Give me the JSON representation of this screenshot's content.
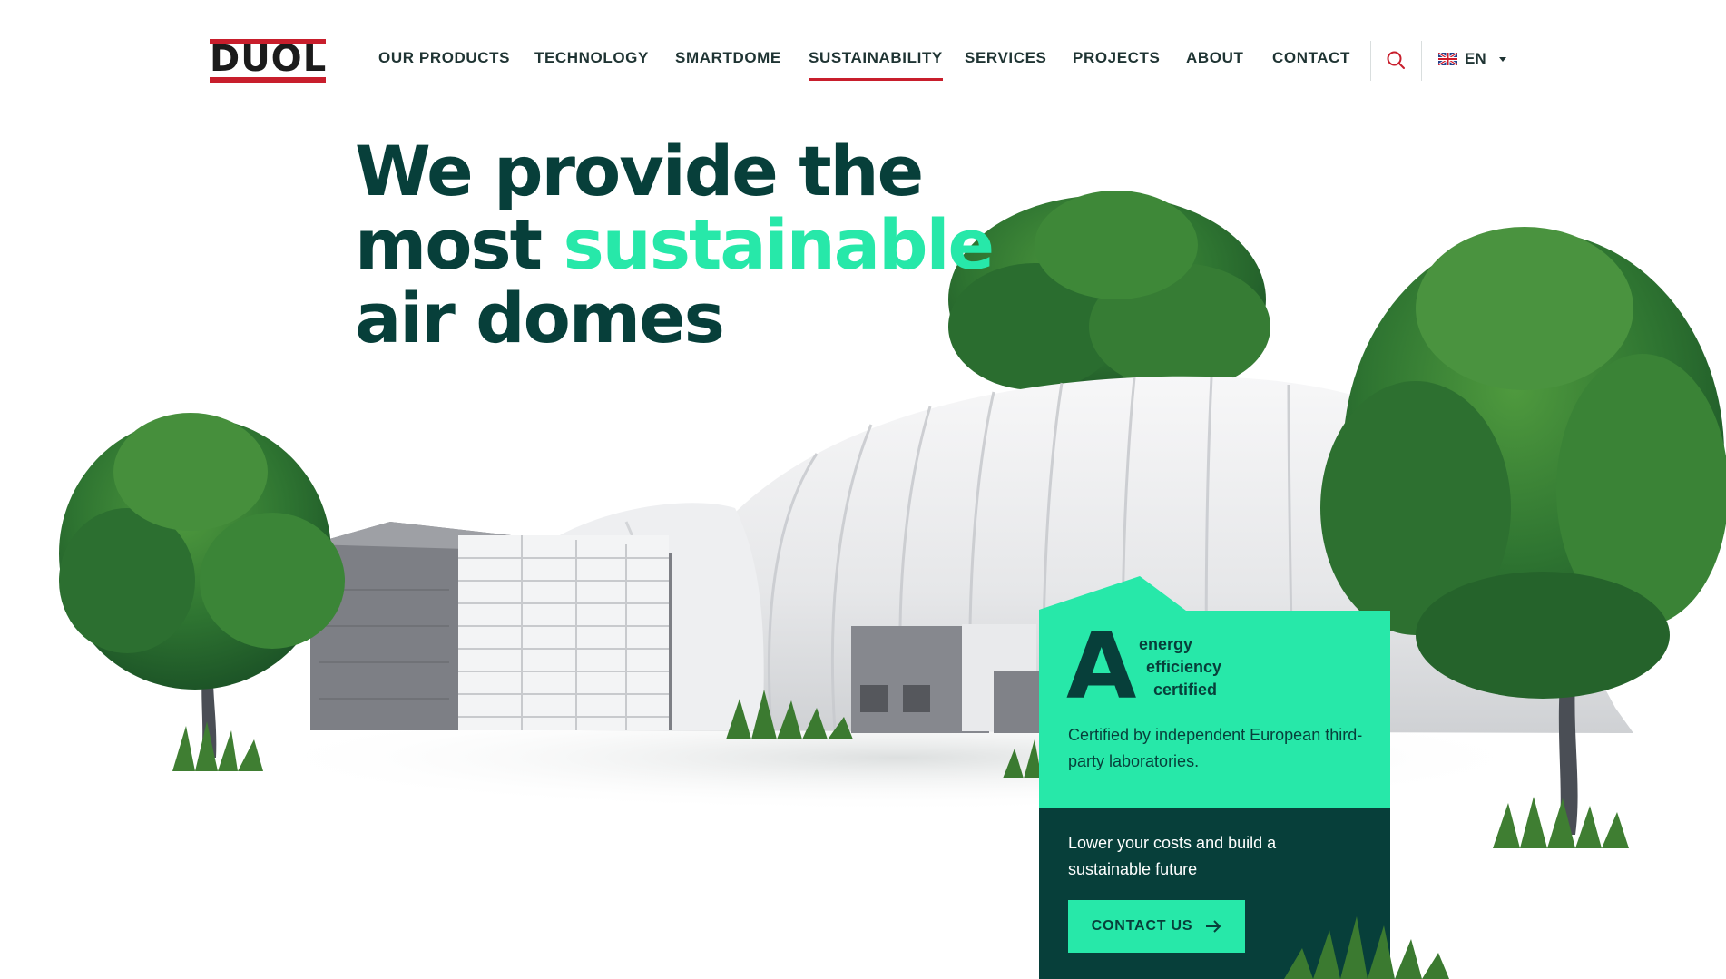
{
  "brand": {
    "logo_text": "DUOL"
  },
  "nav": {
    "items": [
      {
        "label": "OUR PRODUCTS"
      },
      {
        "label": "TECHNOLOGY"
      },
      {
        "label": "SMARTDOME"
      },
      {
        "label": "SUSTAINABILITY",
        "active": true
      },
      {
        "label": "SERVICES"
      },
      {
        "label": "PROJECTS"
      },
      {
        "label": "ABOUT"
      },
      {
        "label": "CONTACT"
      }
    ],
    "search_icon": "search-icon",
    "language": {
      "label": "EN",
      "flag_icon": "uk-flag-icon"
    }
  },
  "hero": {
    "title_line1": "We provide the",
    "title_line2_start": "most ",
    "title_line2_accent": "sustainable",
    "title_line3": "air domes"
  },
  "certification": {
    "grade": "A",
    "line1": "energy",
    "line2": "efficiency",
    "line3": "certified",
    "description": "Certified by independent European third-party laboratories.",
    "cta_text": "Lower your costs and build a sustainable future",
    "cta_button": "CONTACT US"
  },
  "colors": {
    "dark_green": "#073f3a",
    "accent_green": "#27e8a9",
    "brand_red": "#c81e2c",
    "text": "#1f3433"
  }
}
